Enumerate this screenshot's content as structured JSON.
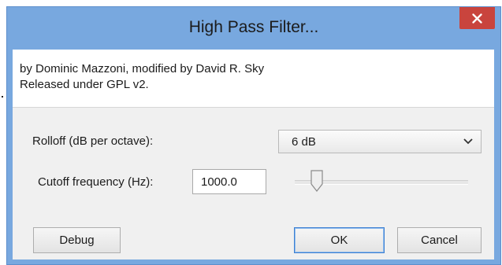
{
  "window": {
    "title": "High Pass Filter..."
  },
  "info": {
    "line1": "by Dominic Mazzoni, modified by David R. Sky",
    "line2": "Released under GPL v2."
  },
  "rolloff": {
    "label": "Rolloff (dB per octave):",
    "selected": "6 dB"
  },
  "cutoff": {
    "label": "Cutoff frequency (Hz):",
    "value": "1000.0",
    "slider_fraction": 0.1
  },
  "buttons": {
    "debug": "Debug",
    "ok": "OK",
    "cancel": "Cancel"
  },
  "colors": {
    "titlebar": "#78a8df",
    "close_button": "#c9443d",
    "dialog_background": "#f0f0f0",
    "default_button_border": "#3c7fd1"
  },
  "icons": {
    "close": "close-icon",
    "dropdown": "chevron-down-icon",
    "slider": "slider-thumb"
  }
}
